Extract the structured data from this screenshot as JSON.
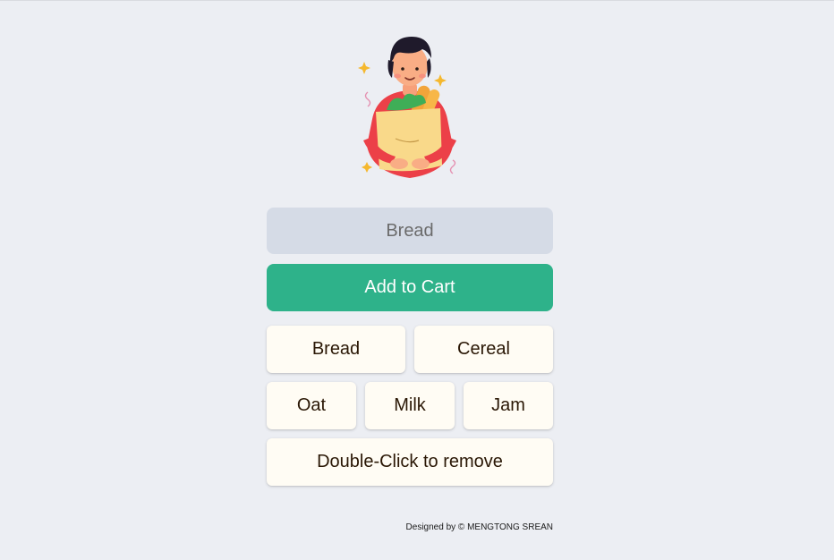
{
  "hero": {
    "icon": "shopper-with-grocery-bag-illustration"
  },
  "form": {
    "input_value": "Bread",
    "add_button_label": "Add to Cart",
    "colors": {
      "button": "#2eb28a",
      "input_bg": "#d5dbe6"
    }
  },
  "list": {
    "rows": [
      [
        "Bread",
        "Cereal"
      ],
      [
        "Oat",
        "Milk",
        "Jam"
      ],
      [
        "Double-Click to remove"
      ]
    ],
    "colors": {
      "item_bg": "#fffcf4",
      "item_text": "#2a1705"
    }
  },
  "footer": {
    "credit": "Designed by © MENGTONG SREAN"
  }
}
